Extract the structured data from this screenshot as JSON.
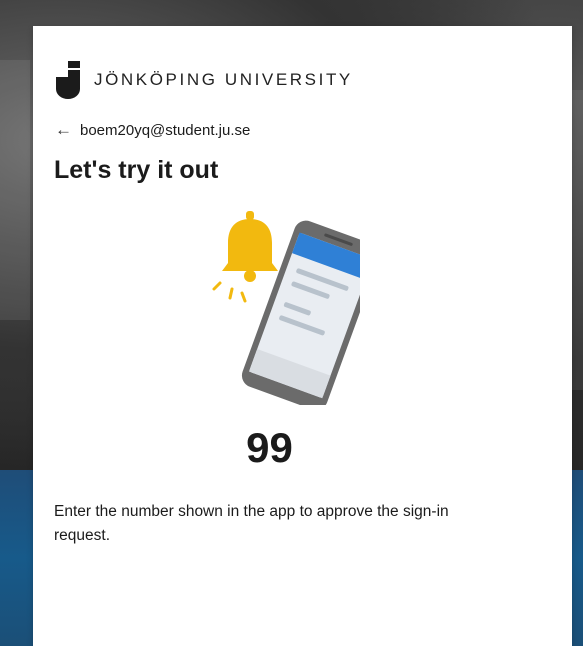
{
  "brand": {
    "name": "JÖNKÖPING UNIVERSITY",
    "color": "#1b1b1b"
  },
  "account": {
    "email": "boem20yq@student.ju.se",
    "back_icon": "arrow-left-icon"
  },
  "heading": "Let's try it out",
  "illustration": {
    "bell_icon": "bell-icon",
    "phone_icon": "phone-icon",
    "accent": "#f2b90f",
    "phone_header": "#2f80d6"
  },
  "code": "99",
  "instruction": "Enter the number shown in the app to approve the sign-in request."
}
